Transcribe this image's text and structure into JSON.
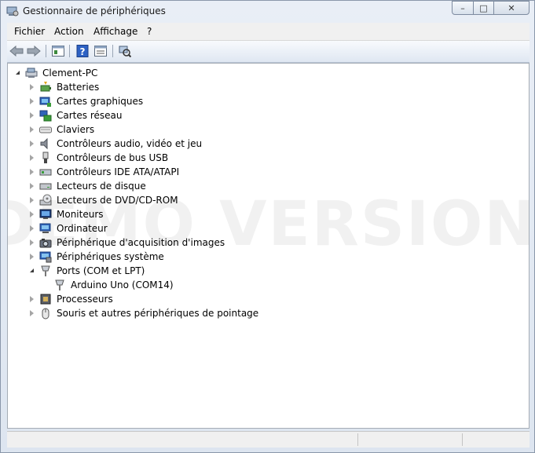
{
  "window": {
    "title": "Gestionnaire de périphériques",
    "controls": {
      "minimize": "–",
      "maximize": "□",
      "close": "✕"
    }
  },
  "menu": [
    "Fichier",
    "Action",
    "Affichage",
    "?"
  ],
  "toolbar": {
    "buttons": [
      "back-arrow-icon",
      "forward-arrow-icon",
      "properties-icon",
      "help-icon",
      "view-icon",
      "scan-hardware-icon"
    ]
  },
  "watermark": "DEMO VERSION",
  "tree": {
    "root": "Clement-PC",
    "categories": [
      {
        "label": "Batteries",
        "icon": "battery-icon",
        "expanded": false
      },
      {
        "label": "Cartes graphiques",
        "icon": "display-adapter-icon",
        "expanded": false
      },
      {
        "label": "Cartes réseau",
        "icon": "network-adapter-icon",
        "expanded": false
      },
      {
        "label": "Claviers",
        "icon": "keyboard-icon",
        "expanded": false
      },
      {
        "label": "Contrôleurs audio, vidéo et jeu",
        "icon": "speaker-icon",
        "expanded": false
      },
      {
        "label": "Contrôleurs de bus USB",
        "icon": "usb-icon",
        "expanded": false
      },
      {
        "label": "Contrôleurs IDE ATA/ATAPI",
        "icon": "ide-controller-icon",
        "expanded": false
      },
      {
        "label": "Lecteurs de disque",
        "icon": "disk-drive-icon",
        "expanded": false
      },
      {
        "label": "Lecteurs de DVD/CD-ROM",
        "icon": "dvd-icon",
        "expanded": false
      },
      {
        "label": "Moniteurs",
        "icon": "monitor-icon",
        "expanded": false
      },
      {
        "label": "Ordinateur",
        "icon": "computer-icon",
        "expanded": false
      },
      {
        "label": "Périphérique d'acquisition d'images",
        "icon": "camera-icon",
        "expanded": false
      },
      {
        "label": "Périphériques système",
        "icon": "system-device-icon",
        "expanded": false
      },
      {
        "label": "Ports (COM et LPT)",
        "icon": "port-icon",
        "expanded": true,
        "children": [
          "Arduino Uno (COM14)"
        ]
      },
      {
        "label": "Processeurs",
        "icon": "processor-icon",
        "expanded": false
      },
      {
        "label": "Souris et autres périphériques de pointage",
        "icon": "mouse-icon",
        "expanded": false
      }
    ]
  },
  "colors": {
    "accent": "#1f5fb4",
    "frame": "#dde5f0",
    "selection": "#cde8ff"
  }
}
